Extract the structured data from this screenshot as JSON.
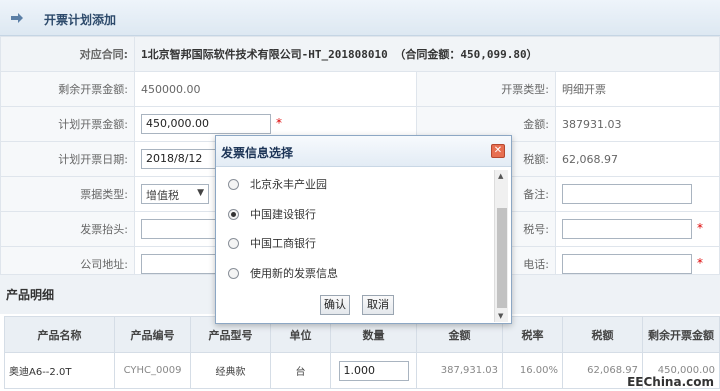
{
  "header": {
    "title": "开票计划添加"
  },
  "form": {
    "contract_label": "对应合同:",
    "contract_value": "1北京智邦国际软件技术有限公司-HT_201808010 （合同金额：450,099.80）",
    "remaining_label": "剩余开票金额:",
    "remaining_value": "450000.00",
    "invoice_type_label": "开票类型:",
    "invoice_type_value": "明细开票",
    "planned_amount_label": "计划开票金额:",
    "planned_amount_value": "450,000.00",
    "amount_label": "金额:",
    "amount_value": "387931.03",
    "planned_date_label": "计划开票日期:",
    "planned_date_value": "2018/8/12",
    "tax_label": "税额:",
    "tax_value": "62,068.97",
    "bill_type_label": "票据类型:",
    "bill_type_value": "增值税",
    "remark_label": "备注:",
    "invoice_header_label": "发票抬头:",
    "tax_no_label": "税号:",
    "address_label": "公司地址:",
    "phone_label": "电话:",
    "required_mark": "*"
  },
  "products": {
    "section_title": "产品明细",
    "columns": [
      "产品名称",
      "产品编号",
      "产品型号",
      "单位",
      "数量",
      "金额",
      "税率",
      "税额",
      "剩余开票金额"
    ],
    "row": {
      "name": "奥迪A6--2.0T",
      "code": "CYHC_0009",
      "model": "经典款",
      "unit": "台",
      "qty": "1.000",
      "amount": "387,931.03",
      "rate": "16.00%",
      "tax": "62,068.97",
      "remaining": "450,000.00"
    }
  },
  "dialog": {
    "title": "发票信息选择",
    "close_icon": "close-icon",
    "options": [
      "北京永丰产业园",
      "中国建设银行",
      "中国工商银行",
      "使用新的发票信息"
    ],
    "selected_index": 1,
    "ok_label": "确认",
    "cancel_label": "取消"
  },
  "watermark": "EEChina.com"
}
